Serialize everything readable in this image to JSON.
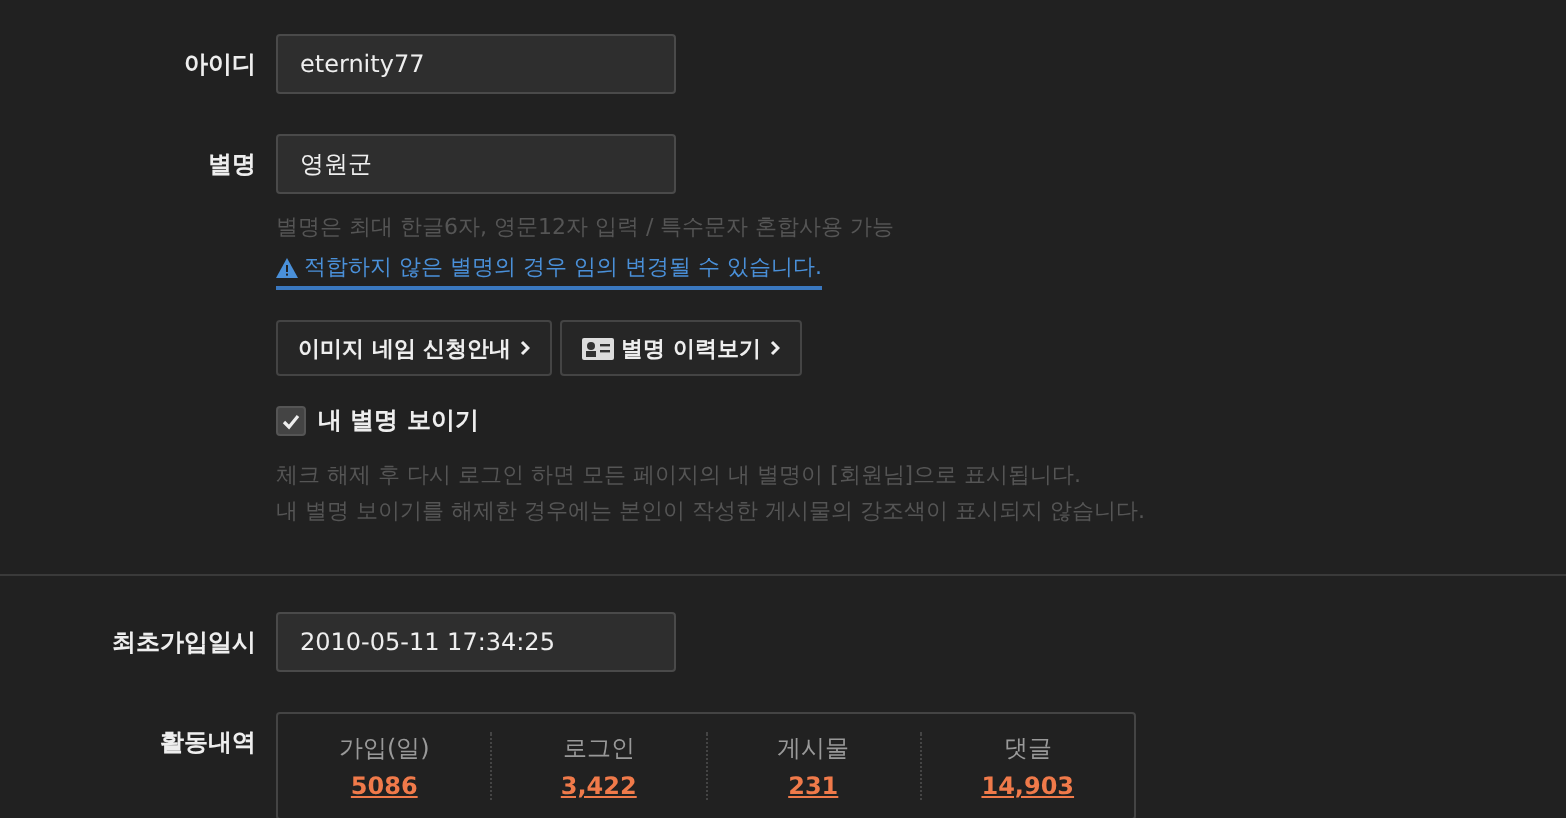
{
  "id_field": {
    "label": "아이디",
    "value": "eternity77"
  },
  "nickname_field": {
    "label": "별명",
    "value": "영원군",
    "hint": "별명은 최대 한글6자, 영문12자 입력 / 특수문자 혼합사용 가능",
    "warning": "적합하지 않은 별명의 경우 임의 변경될 수 있습니다."
  },
  "buttons": [
    {
      "label": "이미지 네임 신청안내",
      "kind": "plain"
    },
    {
      "label": "별명 이력보기",
      "kind": "card"
    }
  ],
  "show_nickname": {
    "label": "내 별명 보이기",
    "checked": true
  },
  "notes": [
    "체크 해제 후 다시 로그인 하면 모든 페이지의 내 별명이 [회원님]으로 표시됩니다.",
    "내 별명 보이기를 해제한 경우에는 본인이 작성한 게시물의 강조색이 표시되지 않습니다."
  ],
  "join_date": {
    "label": "최초가입일시",
    "value": "2010-05-11 17:34:25"
  },
  "activity": {
    "label": "활동내역",
    "stats": [
      {
        "label": "가입(일)",
        "value": "5086"
      },
      {
        "label": "로그인",
        "value": "3,422"
      },
      {
        "label": "게시물",
        "value": "231"
      },
      {
        "label": "댓글",
        "value": "14,903"
      }
    ]
  }
}
